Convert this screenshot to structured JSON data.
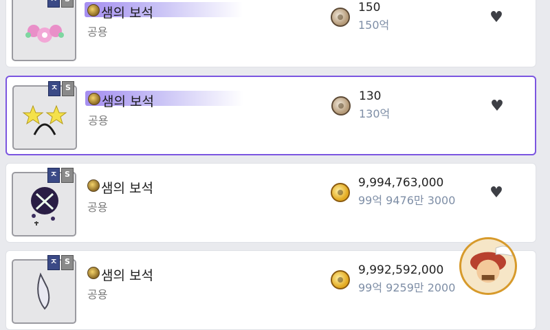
{
  "items": [
    {
      "name": "샘의 보석",
      "category": "공용",
      "price": "150",
      "price_sub": "150억",
      "coin": "bronze",
      "tier_badge": "ㅈ",
      "star_badge": "S",
      "art_icon": "flower-hairband-icon",
      "highlight": true
    },
    {
      "name": "샘의 보석",
      "category": "공용",
      "price": "130",
      "price_sub": "130억",
      "coin": "bronze",
      "tier_badge": "ㅈ",
      "star_badge": "S",
      "art_icon": "star-headband-icon",
      "highlight": true,
      "selected": true
    },
    {
      "name": "샘의 보석",
      "category": "공용",
      "price": "9,994,763,000",
      "price_sub": "99억 9476만 3000",
      "coin": "gold",
      "tier_badge": "ㅈ",
      "star_badge": "S",
      "art_icon": "dark-orb-icon",
      "highlight": false
    },
    {
      "name": "샘의 보석",
      "category": "공용",
      "price": "9,992,592,000",
      "price_sub": "99억 9259만 2000",
      "coin": "gold",
      "tier_badge": "ㅈ",
      "star_badge": "S",
      "art_icon": "silver-feather-icon",
      "highlight": false
    }
  ],
  "colors": {
    "selected_border": "#7b55e0",
    "highlight_gradient": "#a58ef0",
    "price_sub": "#7e8ea6"
  },
  "icons": {
    "favorite": "heart-icon",
    "avatar": "character-avatar-icon"
  }
}
